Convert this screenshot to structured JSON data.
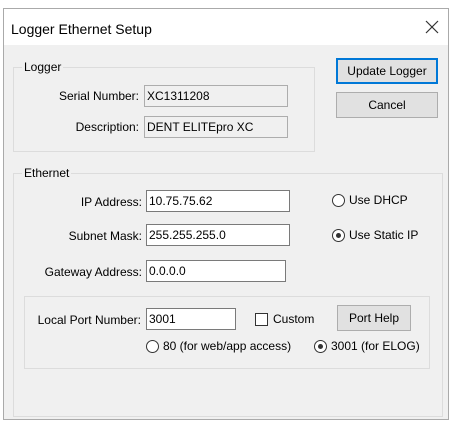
{
  "window": {
    "title": "Logger Ethernet Setup"
  },
  "logger": {
    "group_label": "Logger",
    "serial_label": "Serial Number:",
    "serial_value": "XC1311208",
    "description_label": "Description:",
    "description_value": "DENT ELITEpro XC"
  },
  "buttons": {
    "update": "Update Logger",
    "cancel": "Cancel",
    "port_help": "Port Help"
  },
  "ethernet": {
    "group_label": "Ethernet",
    "ip_label": "IP Address:",
    "ip_value": "10.75.75.62",
    "subnet_label": "Subnet Mask:",
    "subnet_value": "255.255.255.0",
    "gateway_label": "Gateway Address:",
    "gateway_value": "0.0.0.0",
    "use_dhcp": "Use DHCP",
    "use_static": "Use Static IP",
    "selected_mode": "Use Static IP"
  },
  "port": {
    "label": "Local Port Number:",
    "value": "3001",
    "custom_label": "Custom",
    "custom_checked": false,
    "option_80": "80 (for web/app access)",
    "option_3001": "3001 (for ELOG)",
    "selected": "3001 (for ELOG)"
  }
}
